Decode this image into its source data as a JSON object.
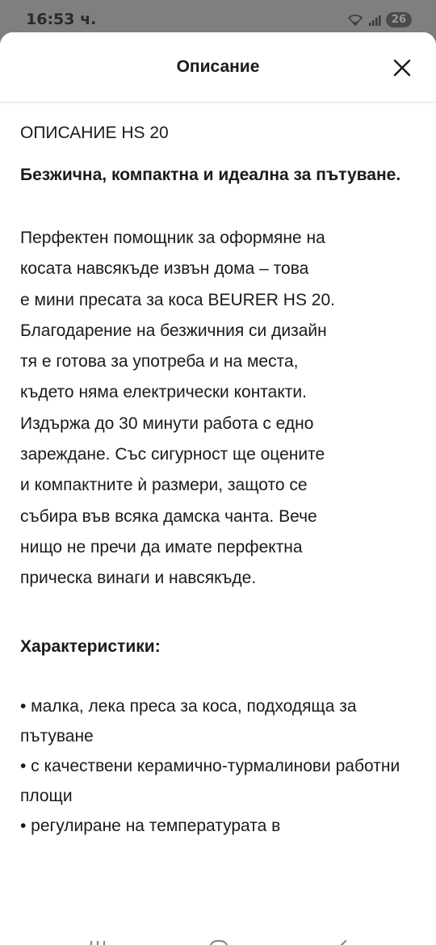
{
  "status_bar": {
    "time": "16:53 ч.",
    "battery": "26",
    "icons": [
      "wifi-icon",
      "signal-icon",
      "battery-icon"
    ]
  },
  "sheet": {
    "title": "Описание",
    "close_icon": "close-icon"
  },
  "content": {
    "heading": "ОПИСАНИЕ HS 20",
    "subheading": "Безжична, компактна и идеална за пътуване.",
    "paragraph_lines": [
      "Перфектен помощник за оформяне на",
      "косата навсякъде извън дома – това",
      "е мини пресата за коса BEURER HS 20.",
      "Благодарение на безжичния си дизайн",
      "тя е готова за употреба и на места,",
      "където няма електрически контакти.",
      "Издържа до 30 минути работа с едно",
      "зареждане. Със сигурност ще оцените",
      "и компактните ѝ размери, защото се",
      "събира във всяка дамска чанта. Вече",
      "нищо не пречи да имате перфектна",
      "прическа винаги и навсякъде."
    ],
    "features_title": "Характеристики:",
    "features": [
      "  • малка, лека преса за коса, подходяща за пътуване",
      "  • с качествени керамично-турмалинови работни площи",
      "  • регулиране на температурата в"
    ]
  },
  "nav_bar": {
    "icons": [
      "recent-apps-icon",
      "home-icon",
      "back-icon"
    ]
  },
  "colors": {
    "overlay": "#7a7a7a",
    "sheet_bg": "#ffffff",
    "text": "#1a1a1a"
  }
}
